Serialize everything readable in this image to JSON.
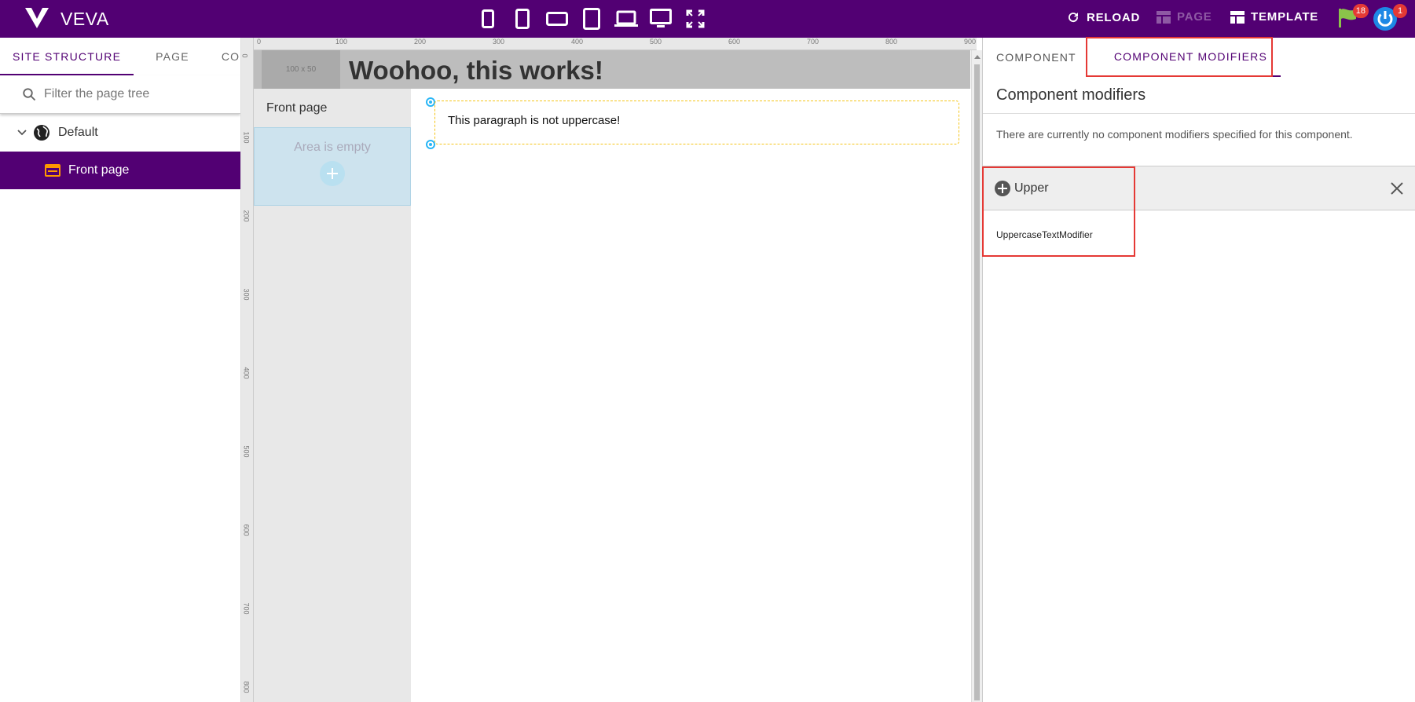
{
  "header": {
    "brand": "VEVA",
    "devices": [
      "phone-small-icon",
      "phone-icon",
      "phone-landscape-icon",
      "tablet-icon",
      "laptop-icon",
      "desktop-icon",
      "fullscreen-icon"
    ],
    "reload_label": "RELOAD",
    "page_label": "PAGE",
    "template_label": "TEMPLATE",
    "flag_count": "18",
    "power_count": "1"
  },
  "left_panel": {
    "tabs": [
      "SITE STRUCTURE",
      "PAGE",
      "CONT"
    ],
    "filter_placeholder": "Filter the page tree",
    "tree": [
      {
        "label": "Default",
        "icon": "globe-icon"
      },
      {
        "label": "Front page",
        "icon": "page-icon"
      }
    ]
  },
  "ruler": {
    "h_labels": [
      "0",
      "100",
      "200",
      "300",
      "400",
      "500",
      "600",
      "700",
      "800",
      "900"
    ],
    "v_labels": [
      "0",
      "100",
      "200",
      "300",
      "400",
      "500",
      "600",
      "700",
      "800"
    ]
  },
  "canvas": {
    "logo_placeholder": "100 x 50",
    "site_title": "Woohoo, this works!",
    "sidebar_nav": "Front page",
    "empty_area": "Area is empty",
    "paragraph": "This paragraph is not uppercase!"
  },
  "right_panel": {
    "tabs": [
      "COMPONENT",
      "COMPONENT MODIFIERS"
    ],
    "title": "Component modifiers",
    "note": "There are currently no component modifiers specified for this component.",
    "modifier_search": "Upper",
    "modifier_result": "UppercaseTextModifier"
  },
  "colors": {
    "brand": "#520073",
    "highlight": "#e53935",
    "accent": "#29b6f6"
  }
}
